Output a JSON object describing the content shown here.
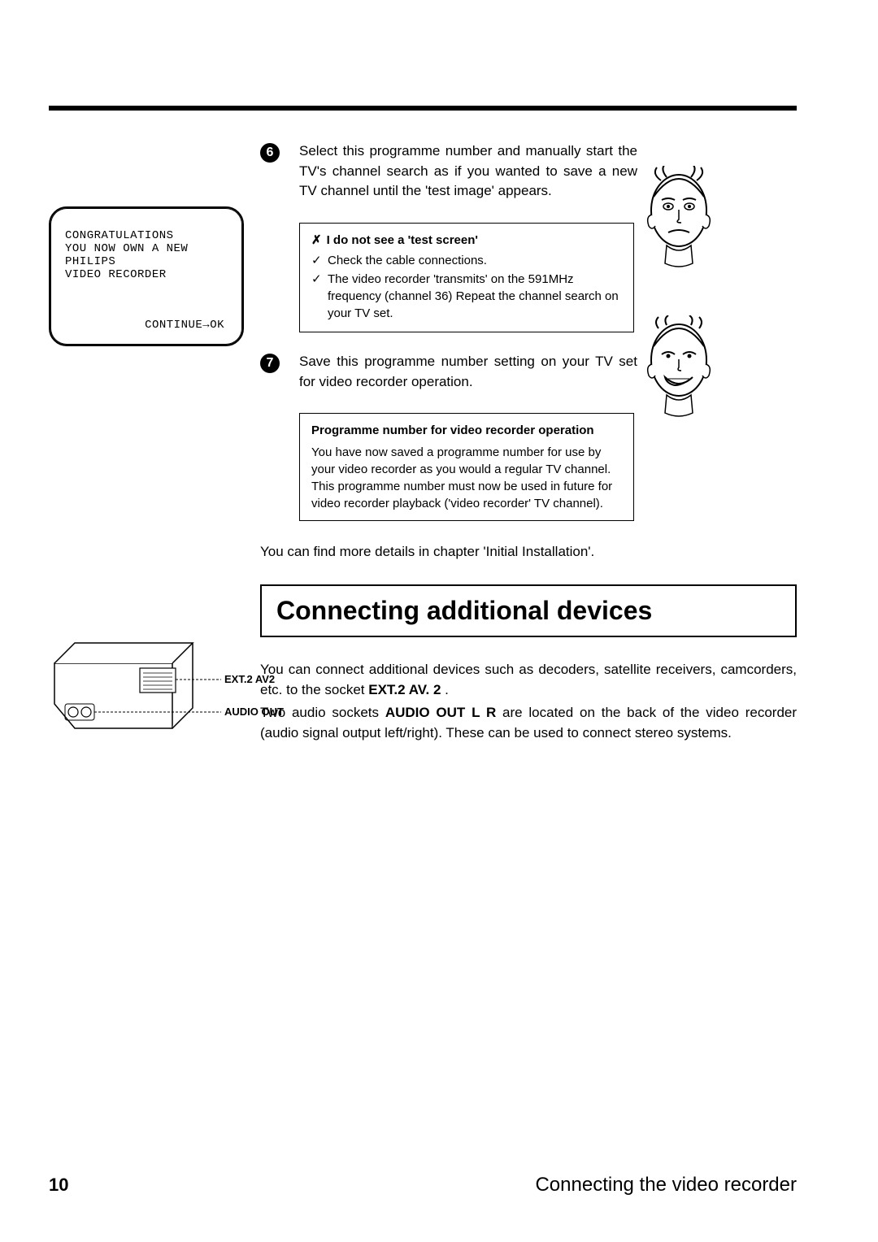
{
  "tvScreen": {
    "line1": "CONGRATULATIONS",
    "line2": "YOU NOW OWN A NEW",
    "line3": "PHILIPS",
    "line4": "VIDEO RECORDER",
    "continue": "CONTINUE→OK"
  },
  "step6": {
    "num": "6",
    "text": "Select this programme number and manually start the TV's channel search as if you wanted to save a new TV channel until the 'test image' appears."
  },
  "tipBox1": {
    "title": "I do not see a 'test screen'",
    "item1": "Check the cable connections.",
    "item2": "The video recorder 'transmits' on the 591MHz frequency (channel 36) Repeat the channel search on your TV set."
  },
  "step7": {
    "num": "7",
    "text": "Save this programme number setting on your TV set for video recorder operation."
  },
  "infoBox1": {
    "title": "Programme number for video recorder operation",
    "body": "You have now saved a programme number for use by your video recorder as you would a regular TV channel. This programme number must now be used in future for video recorder playback ('video recorder' TV channel)."
  },
  "moreDetails": "You can find more details in chapter 'Initial Installation'.",
  "sectionHeading": "Connecting additional devices",
  "para1_a": "You can connect additional devices such as decoders, satellite receivers, camcorders, etc. to the socket ",
  "para1_b": "EXT.2  AV. 2",
  "para1_c": " .",
  "para2_a": "Two audio sockets ",
  "para2_b": "AUDIO OUT L R",
  "para2_c": " are located on the back of the video recorder (audio signal output left/right). These can be used to connect stereo systems.",
  "connLabel1": "EXT.2 AV2",
  "connLabel2": "AUDIO OUT",
  "pageNum": "10",
  "footerTitle": "Connecting the video recorder"
}
